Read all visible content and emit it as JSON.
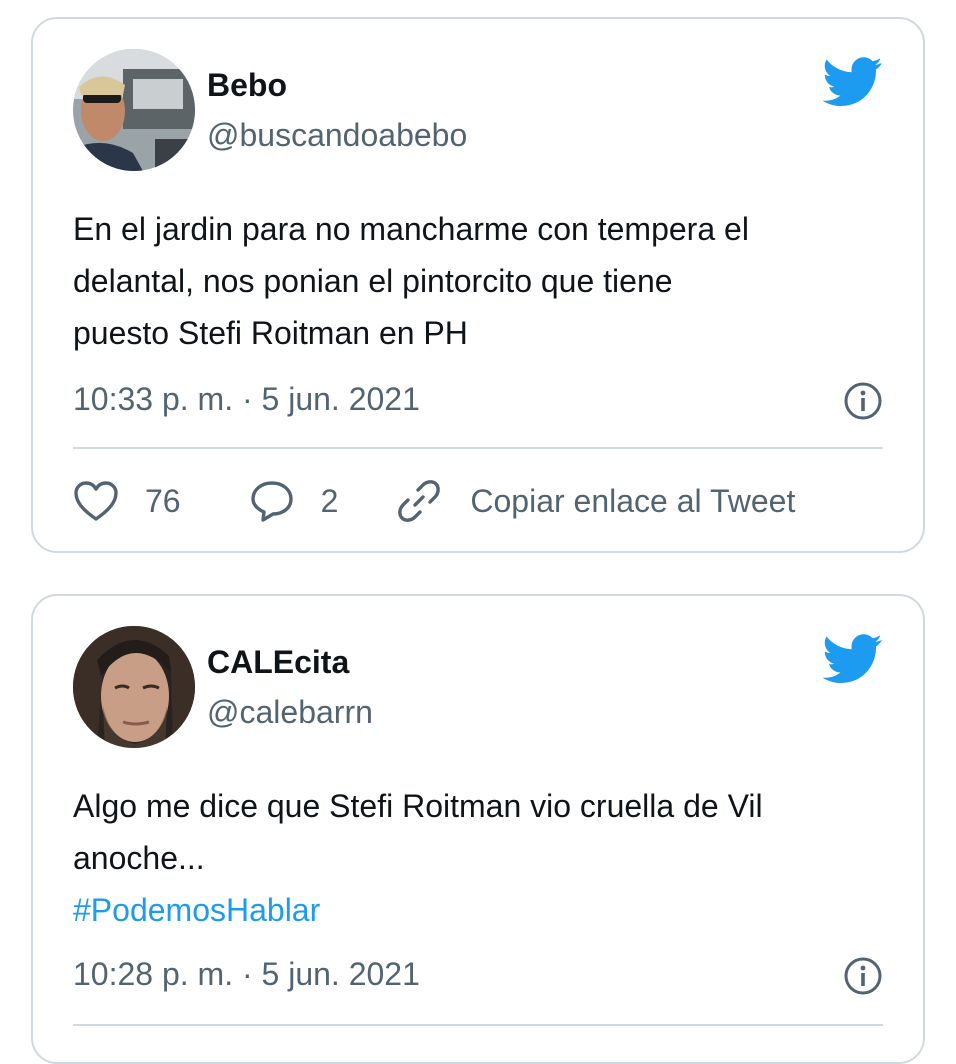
{
  "tweets": [
    {
      "name": "Bebo",
      "handle": "@buscandoabebo",
      "text_lines": [
        "En el jardin para no mancharme con tempera el",
        "delantal, nos ponian el pintorcito que tiene",
        "puesto Stefi Roitman en PH"
      ],
      "hashtag": "",
      "timestamp": "10:33 p. m. · 5 jun. 2021",
      "likes": "76",
      "replies": "2",
      "copy_link_label": "Copiar enlace al Tweet"
    },
    {
      "name": "CALEcita",
      "handle": "@calebarrn",
      "text_lines": [
        "Algo me dice que Stefi Roitman vio cruella de Vil",
        "anoche..."
      ],
      "hashtag": "#PodemosHablar",
      "timestamp": "10:28 p. m. · 5 jun. 2021"
    }
  ],
  "icons": {
    "brand": "twitter-bird-icon",
    "info": "info-icon",
    "like": "heart-icon",
    "reply": "speech-bubble-icon",
    "copy": "link-icon"
  },
  "colors": {
    "accent": "#1d9bf0",
    "secondary_text": "#536471",
    "border": "#cfd9de"
  }
}
